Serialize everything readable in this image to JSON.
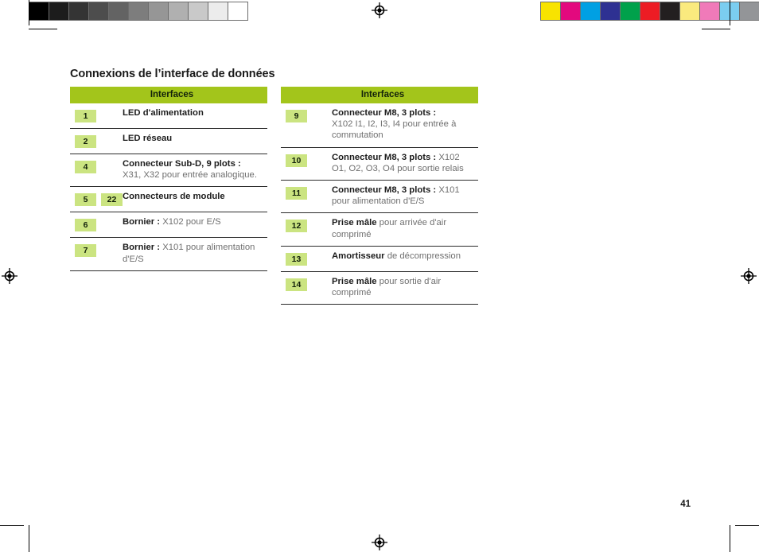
{
  "document": {
    "title": "Connexions de l’interface de données",
    "page_number": "41"
  },
  "colors": {
    "header_green": "#a3c51b",
    "badge_green": "#cbe481",
    "label_text": "#1c1c1c",
    "body_text": "#6f6f6f"
  },
  "print_marks": {
    "grayscale_patches": [
      "#000000",
      "#1c1c1c",
      "#343434",
      "#4d4d4d",
      "#636363",
      "#7d7d7d",
      "#969696",
      "#b0b0b0",
      "#c9c9c9",
      "#ececec",
      "#ffffff"
    ],
    "color_patches": [
      "#f8e300",
      "#e3097e",
      "#00a0e3",
      "#2e3192",
      "#00a14b",
      "#ed1c24",
      "#231f20",
      "#faea7e",
      "#f07ab9",
      "#7bcdf0",
      "#939598"
    ],
    "registration_icon": "registration-target-icon"
  },
  "tables": [
    {
      "id": "left",
      "header": "Interfaces",
      "rows": [
        {
          "badges": [
            "1"
          ],
          "label": "LED d'alimentation",
          "detail": ""
        },
        {
          "badges": [
            "2"
          ],
          "label": "LED réseau",
          "detail": ""
        },
        {
          "badges": [
            "4"
          ],
          "label": "Connecteur Sub-D, 9 plots :",
          "detail": "X31, X32 pour entrée analogique.",
          "detail_newline": true
        },
        {
          "badges": [
            "5",
            "22"
          ],
          "label": "Connecteurs de module",
          "detail": ""
        },
        {
          "badges": [
            "6"
          ],
          "label": "Bornier :",
          "detail": "X102 pour E/S"
        },
        {
          "badges": [
            "7"
          ],
          "label": "Bornier :",
          "detail": "X101 pour alimentation d'E/S"
        }
      ]
    },
    {
      "id": "right",
      "header": "Interfaces",
      "rows": [
        {
          "badges": [
            "9"
          ],
          "label": "Connecteur M8, 3 plots :",
          "detail": "X102 I1, I2, I3, I4 pour entrée à commutation",
          "detail_newline": true
        },
        {
          "badges": [
            "10"
          ],
          "label": "Connecteur M8, 3 plots :",
          "detail": "X102 O1, O2, O3, O4 pour sortie relais"
        },
        {
          "badges": [
            "11"
          ],
          "label": "Connecteur M8, 3 plots :",
          "detail": "X101 pour alimentation d'E/S"
        },
        {
          "badges": [
            "12"
          ],
          "label": "Prise mâle",
          "detail": "pour arrivée d'air comprimé"
        },
        {
          "badges": [
            "13"
          ],
          "label": "Amortisseur",
          "detail": "de décompression"
        },
        {
          "badges": [
            "14"
          ],
          "label": "Prise mâle",
          "detail": "pour sortie d'air comprimé"
        }
      ]
    }
  ]
}
